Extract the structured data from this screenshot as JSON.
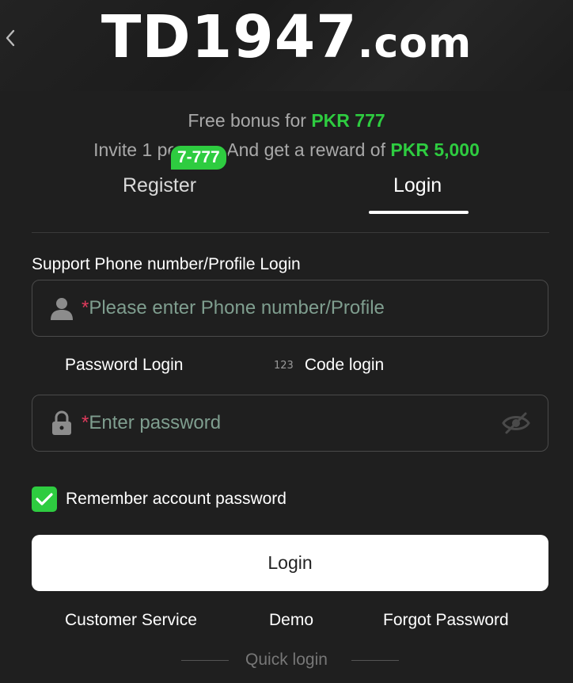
{
  "header": {
    "logo_main": "TD1947",
    "logo_suffix": ".com"
  },
  "promo": {
    "line1_prefix": "Free bonus for",
    "line1_amount": "PKR 777",
    "line2_prefix": "Invite 1 pe",
    "line2_middle": "And get a reward of",
    "line2_amount": "PKR 5,000"
  },
  "tabs": {
    "register_label": "Register",
    "register_badge": "7-777",
    "login_label": "Login",
    "active": "Login"
  },
  "form": {
    "support_label": "Support Phone number/Profile Login",
    "phone_required_mark": "*",
    "phone_placeholder": "Please enter Phone number/Profile",
    "phone_value": "",
    "password_mode_label": "Password Login",
    "code_mode_prefix": "123",
    "code_mode_label": "Code login",
    "password_required_mark": "*",
    "password_placeholder": "Enter password",
    "password_value": "",
    "remember_label": "Remember account password",
    "remember_checked": true,
    "submit_label": "Login"
  },
  "links": {
    "customer_service": "Customer Service",
    "demo": "Demo",
    "forgot_password": "Forgot Password"
  },
  "quick_login_label": "Quick login",
  "icons": {
    "back": "chevron-left-icon",
    "user": "user-icon",
    "lock": "lock-icon",
    "eye": "eye-off-icon",
    "check": "check-icon"
  },
  "colors": {
    "accent_green": "#2ecc40",
    "required_red": "#e03a5c",
    "placeholder": "#7f9e8f",
    "background": "#1f1f1f"
  }
}
